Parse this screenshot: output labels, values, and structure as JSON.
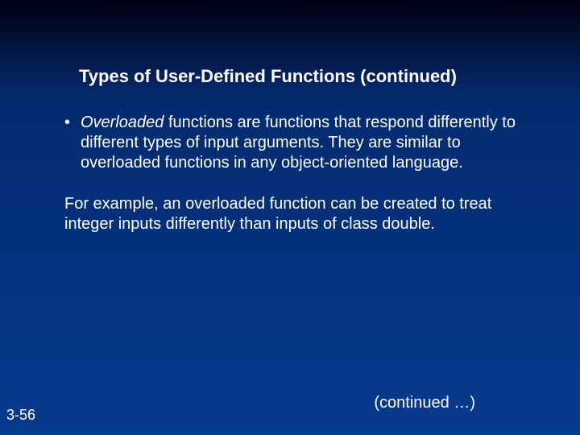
{
  "slide": {
    "title": "Types of User-Defined Functions (continued)",
    "bullet_mark": "•",
    "bullet_italic_lead": "Overloaded",
    "bullet_rest": " functions are functions that respond differently to different types of input arguments. They are similar to overloaded functions in any object-oriented language.",
    "paragraph2": "For example, an overloaded function can be created to treat integer inputs differently  than inputs of class double.",
    "continued": "(continued …)",
    "page_number": "3-56"
  }
}
